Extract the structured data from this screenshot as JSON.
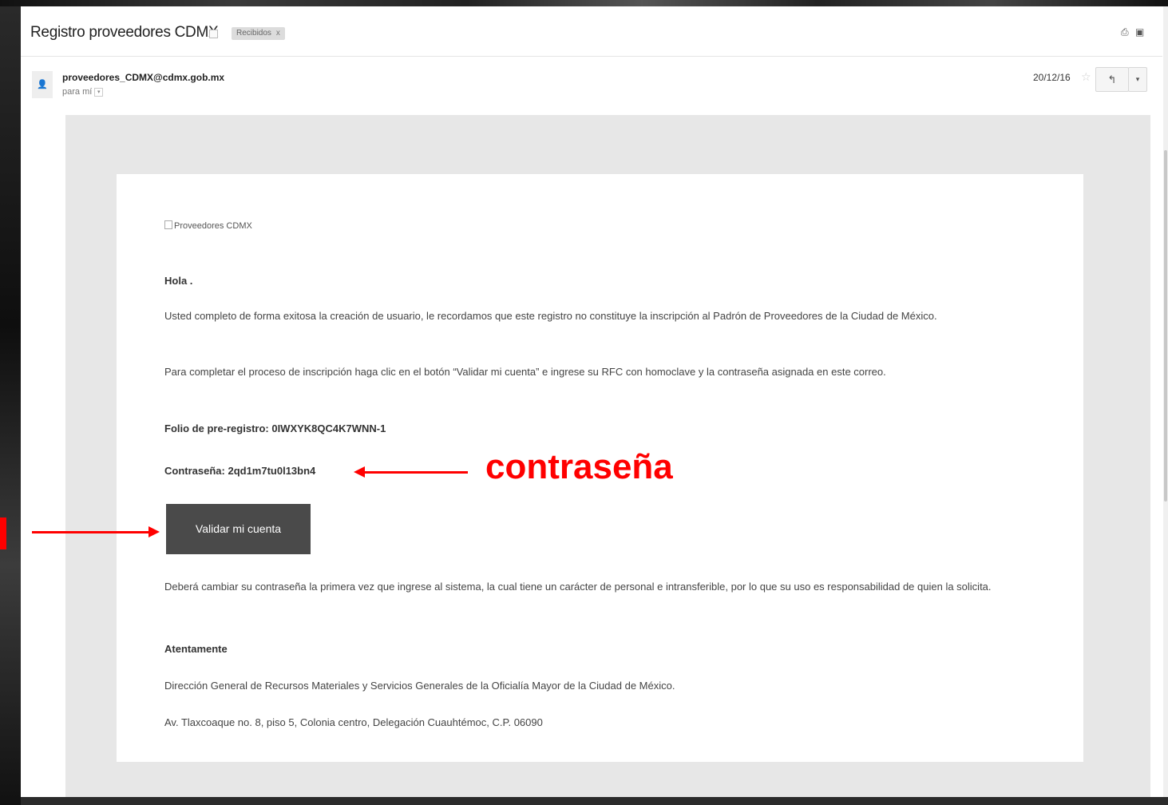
{
  "header": {
    "subject": "Registro proveedores CDMX",
    "label": "Recibidos",
    "label_close": "x",
    "print_icon": "print-icon",
    "newwin_icon": "new-window-icon"
  },
  "message": {
    "sender": "proveedores_CDMX@cdmx.gob.mx",
    "recipient": "para mí",
    "date": "20/12/16",
    "reply_glyph": "↰",
    "more_glyph": "▾",
    "star_glyph": "☆"
  },
  "body": {
    "image_alt": "Proveedores CDMX",
    "greeting": "Hola .",
    "p1": "Usted completo de forma exitosa la creación de usuario, le recordamos que este registro no constituye la inscripción al Padrón de Proveedores de la Ciudad de México.",
    "p2": "Para completar el proceso de inscripción haga clic en el botón “Validar mi cuenta” e ingrese su RFC con homoclave y la contraseña asignada en este correo.",
    "folio": "Folio de pre-registro: 0IWXYK8QC4K7WNN-1",
    "password": "Contraseña: 2qd1m7tu0l13bn4",
    "button_label": "Validar mi cuenta",
    "p3": "Deberá cambiar su contraseña la primera vez que ingrese al sistema, la cual tiene un carácter de personal e intransferible, por lo que su uso es responsabilidad de quien la solicita.",
    "closing": "Atentamente",
    "org": "Dirección General de Recursos Materiales y Servicios Generales de la Oficialía Mayor de la Ciudad de México.",
    "address": "Av. Tlaxcoaque no. 8, piso 5, Colonia centro, Delegación Cuauhtémoc, C.P. 06090"
  },
  "annotation": {
    "label": "contraseña",
    "color": "#ff0000"
  }
}
